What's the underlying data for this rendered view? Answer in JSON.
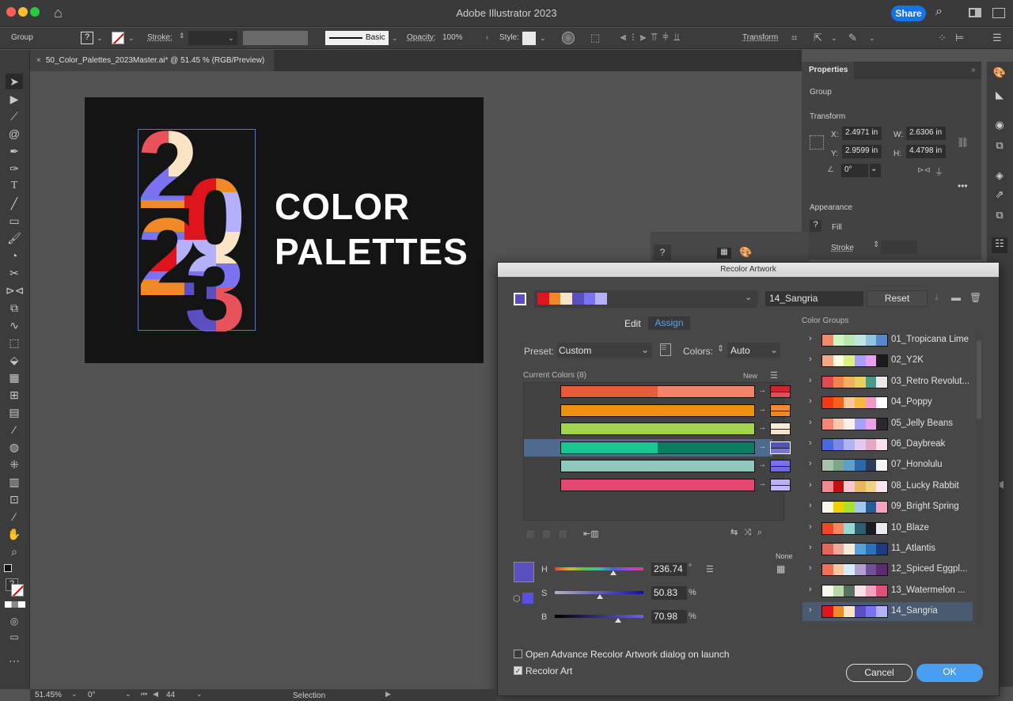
{
  "app": {
    "title": "Adobe Illustrator 2023",
    "share_label": "Share"
  },
  "controlbar": {
    "selection_type": "Group",
    "fill_value": "?",
    "stroke_label": "Stroke:",
    "brush_label": "Basic",
    "opacity_label": "Opacity:",
    "opacity_value": "100%",
    "style_label": "Style:",
    "transform_label": "Transform"
  },
  "document": {
    "tab_title": "50_Color_Palettes_2023Master.ai* @ 51.45 % (RGB/Preview)"
  },
  "artboard": {
    "line1": "COLOR",
    "line2": "PALETTES",
    "numeral": "2023"
  },
  "properties": {
    "title": "Properties",
    "type": "Group",
    "transform_label": "Transform",
    "x_label": "X:",
    "x": "2.4971 in",
    "y_label": "Y:",
    "y": "2.9599 in",
    "w_label": "W:",
    "w": "2.6306 in",
    "h_label": "H:",
    "h": "4.4798 in",
    "angle": "0°",
    "appearance_label": "Appearance",
    "fill_label": "Fill",
    "stroke_label": "Stroke",
    "fill_value": "?"
  },
  "recolor": {
    "title": "Recolor Artwork",
    "current_group_colors": [
      "#e0141c",
      "#f08a28",
      "#fae4c6",
      "#5a4ec0",
      "#7a72f0",
      "#b4b0fa"
    ],
    "group_name": "14_Sangria",
    "reset_label": "Reset",
    "tabs": {
      "edit": "Edit",
      "assign": "Assign",
      "active": "assign"
    },
    "preset_label": "Preset:",
    "preset_value": "Custom",
    "colors_label": "Colors:",
    "colors_value": "Auto",
    "current_colors_label": "Current Colors (8)",
    "new_label": "New",
    "color_rows": [
      {
        "current": [
          "#e75c3a",
          "#f0856a"
        ],
        "new": [
          "#d42030",
          "#e24f58"
        ],
        "selected": false
      },
      {
        "current": [
          "#eb920f"
        ],
        "new": [
          "#f08a30",
          "#e88828"
        ],
        "selected": false
      },
      {
        "current": [
          "#a3d24e"
        ],
        "new": [
          "#f8ecd8",
          "#f6e2c8"
        ],
        "selected": false
      },
      {
        "current": [
          "#18c690",
          "#0c7c60"
        ],
        "new": [
          "#5450c0",
          "#7a76d8"
        ],
        "selected": true
      },
      {
        "current": [
          "#8ec8bc"
        ],
        "new": [
          "#7a70f0",
          "#7068e8"
        ],
        "selected": false
      },
      {
        "current": [
          "#e3466f"
        ],
        "new": [
          "#b8b0f8",
          "#c0b8fa"
        ],
        "selected": false
      }
    ],
    "hsb": {
      "h_label": "H",
      "h_value": "236.74",
      "h_unit": "°",
      "h_fraction": 0.66,
      "s_label": "S",
      "s_value": "50.83",
      "s_unit": "%",
      "s_fraction": 0.51,
      "b_label": "B",
      "b_value": "70.98",
      "b_unit": "%",
      "b_fraction": 0.71,
      "swatch_color": "#5a50c0"
    },
    "none_label": "None",
    "color_groups_label": "Color Groups",
    "color_groups": [
      {
        "name": "01_Tropicana Lime",
        "colors": [
          "#f08a68",
          "#ccf5c0",
          "#b8e8b0",
          "#c0e4e0",
          "#90c4dc",
          "#5a88cc"
        ]
      },
      {
        "name": "02_Y2K",
        "colors": [
          "#f6a880",
          "#fffce0",
          "#daf080",
          "#a8a0f8",
          "#e8a0f0",
          "#1c1c1c"
        ]
      },
      {
        "name": "03_Retro Revolut...",
        "colors": [
          "#e04a50",
          "#f0844a",
          "#f0b060",
          "#e8d060",
          "#4a9a88",
          "#ece6ea"
        ]
      },
      {
        "name": "04_Poppy",
        "colors": [
          "#f03c14",
          "#f86018",
          "#f8c898",
          "#f8b840",
          "#f498c8",
          "#ffffff"
        ]
      },
      {
        "name": "05_Jelly Beans",
        "colors": [
          "#f48878",
          "#f8c8b0",
          "#fcf0ec",
          "#a8a0f8",
          "#eca0e8",
          "#2a2a2a"
        ]
      },
      {
        "name": "06_Daybreak",
        "colors": [
          "#4a68e0",
          "#7c88e8",
          "#b0b4f0",
          "#e4c8f0",
          "#e4a8c0",
          "#f8e0ec"
        ]
      },
      {
        "name": "07_Honolulu",
        "colors": [
          "#a8c0a8",
          "#78a888",
          "#5aa0c8",
          "#2c68a8",
          "#2c3c58",
          "#f4f4f8"
        ]
      },
      {
        "name": "08_Lucky Rabbit",
        "colors": [
          "#f08890",
          "#c01010",
          "#f8c8d0",
          "#e8b860",
          "#f0d088",
          "#f8e4ec"
        ]
      },
      {
        "name": "09_Bright Spring",
        "colors": [
          "#fcf6e4",
          "#f0d000",
          "#a8e030",
          "#a0c8f0",
          "#285c98",
          "#f4a4c0"
        ]
      },
      {
        "name": "10_Blaze",
        "colors": [
          "#f04828",
          "#f48860",
          "#98d8d0",
          "#2c6070",
          "#1c1c20",
          "#ececf0"
        ]
      },
      {
        "name": "11_Atlantis",
        "colors": [
          "#e06858",
          "#f0a898",
          "#f8ecd8",
          "#58a0d8",
          "#2c70b8",
          "#1c3c80"
        ]
      },
      {
        "name": "12_Spiced Eggpl...",
        "colors": [
          "#f07058",
          "#f8c8a0",
          "#d8ecf8",
          "#b0a0d0",
          "#705098",
          "#5c2c70"
        ]
      },
      {
        "name": "13_Watermelon ...",
        "colors": [
          "#f8f8ec",
          "#b8d8a8",
          "#587060",
          "#f8e0e8",
          "#f0a0c0",
          "#e05078"
        ]
      },
      {
        "name": "14_Sangria",
        "colors": [
          "#e0141c",
          "#f08a28",
          "#fae4c6",
          "#5a4ec0",
          "#7a72f0",
          "#b4b0fa"
        ],
        "selected": true
      }
    ],
    "open_advance_label": "Open Advance Recolor Artwork dialog on launch",
    "open_advance_checked": false,
    "recolor_art_label": "Recolor Art",
    "recolor_art_checked": true,
    "cancel_label": "Cancel",
    "ok_label": "OK"
  },
  "statusbar": {
    "zoom": "51.45%",
    "rotation": "0°",
    "artboard": "44",
    "tool": "Selection"
  },
  "colors": {
    "accent": "#1473e6",
    "ok_button": "#4a9ef0",
    "assign_tab": "#5aa0f0"
  }
}
